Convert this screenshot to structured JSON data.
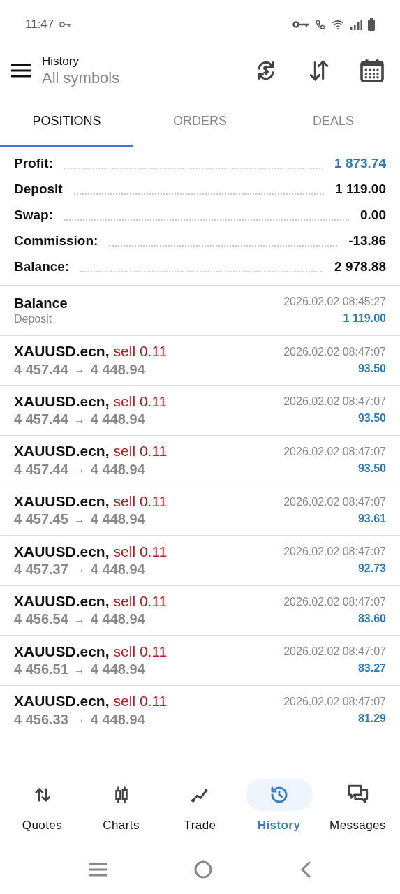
{
  "status_bar": {
    "time": "11:47"
  },
  "header": {
    "title": "History",
    "subtitle": "All symbols"
  },
  "tabs": [
    {
      "label": "POSITIONS",
      "selected": true
    },
    {
      "label": "ORDERS",
      "selected": false
    },
    {
      "label": "DEALS",
      "selected": false
    }
  ],
  "summary": [
    {
      "label": "Profit:",
      "value": "1 873.74",
      "kind": "accent"
    },
    {
      "label": "Deposit",
      "value": "1 119.00",
      "kind": "plain"
    },
    {
      "label": "Swap:",
      "value": "0.00",
      "kind": "plain"
    },
    {
      "label": "Commission:",
      "value": "-13.86",
      "kind": "plain"
    },
    {
      "label": "Balance:",
      "value": "2 978.88",
      "kind": "plain"
    }
  ],
  "rows": [
    {
      "kind": "balance",
      "title": "Balance",
      "subtitle": "Deposit",
      "time": "2026.02.02 08:45:27",
      "amount": "1 119.00"
    },
    {
      "kind": "trade",
      "symbol": "XAUUSD.ecn,",
      "side": "sell 0.11",
      "open": "4 457.44",
      "arrow": "→",
      "close": "4 448.94",
      "time": "2026.02.02 08:47:07",
      "amount": "93.50"
    },
    {
      "kind": "trade",
      "symbol": "XAUUSD.ecn,",
      "side": "sell 0.11",
      "open": "4 457.44",
      "arrow": "→",
      "close": "4 448.94",
      "time": "2026.02.02 08:47:07",
      "amount": "93.50"
    },
    {
      "kind": "trade",
      "symbol": "XAUUSD.ecn,",
      "side": "sell 0.11",
      "open": "4 457.44",
      "arrow": "→",
      "close": "4 448.94",
      "time": "2026.02.02 08:47:07",
      "amount": "93.50"
    },
    {
      "kind": "trade",
      "symbol": "XAUUSD.ecn,",
      "side": "sell 0.11",
      "open": "4 457.45",
      "arrow": "→",
      "close": "4 448.94",
      "time": "2026.02.02 08:47:07",
      "amount": "93.61"
    },
    {
      "kind": "trade",
      "symbol": "XAUUSD.ecn,",
      "side": "sell 0.11",
      "open": "4 457.37",
      "arrow": "→",
      "close": "4 448.94",
      "time": "2026.02.02 08:47:07",
      "amount": "92.73"
    },
    {
      "kind": "trade",
      "symbol": "XAUUSD.ecn,",
      "side": "sell 0.11",
      "open": "4 456.54",
      "arrow": "→",
      "close": "4 448.94",
      "time": "2026.02.02 08:47:07",
      "amount": "83.60"
    },
    {
      "kind": "trade",
      "symbol": "XAUUSD.ecn,",
      "side": "sell 0.11",
      "open": "4 456.51",
      "arrow": "→",
      "close": "4 448.94",
      "time": "2026.02.02 08:47:07",
      "amount": "83.27"
    },
    {
      "kind": "trade",
      "symbol": "XAUUSD.ecn,",
      "side": "sell 0.11",
      "open": "4 456.33",
      "arrow": "→",
      "close": "4 448.94",
      "time": "2026.02.02 08:47:07",
      "amount": "81.29"
    }
  ],
  "bottom_nav": [
    {
      "label": "Quotes",
      "selected": false
    },
    {
      "label": "Charts",
      "selected": false
    },
    {
      "label": "Trade",
      "selected": false
    },
    {
      "label": "History",
      "selected": true
    },
    {
      "label": "Messages",
      "selected": false
    }
  ]
}
